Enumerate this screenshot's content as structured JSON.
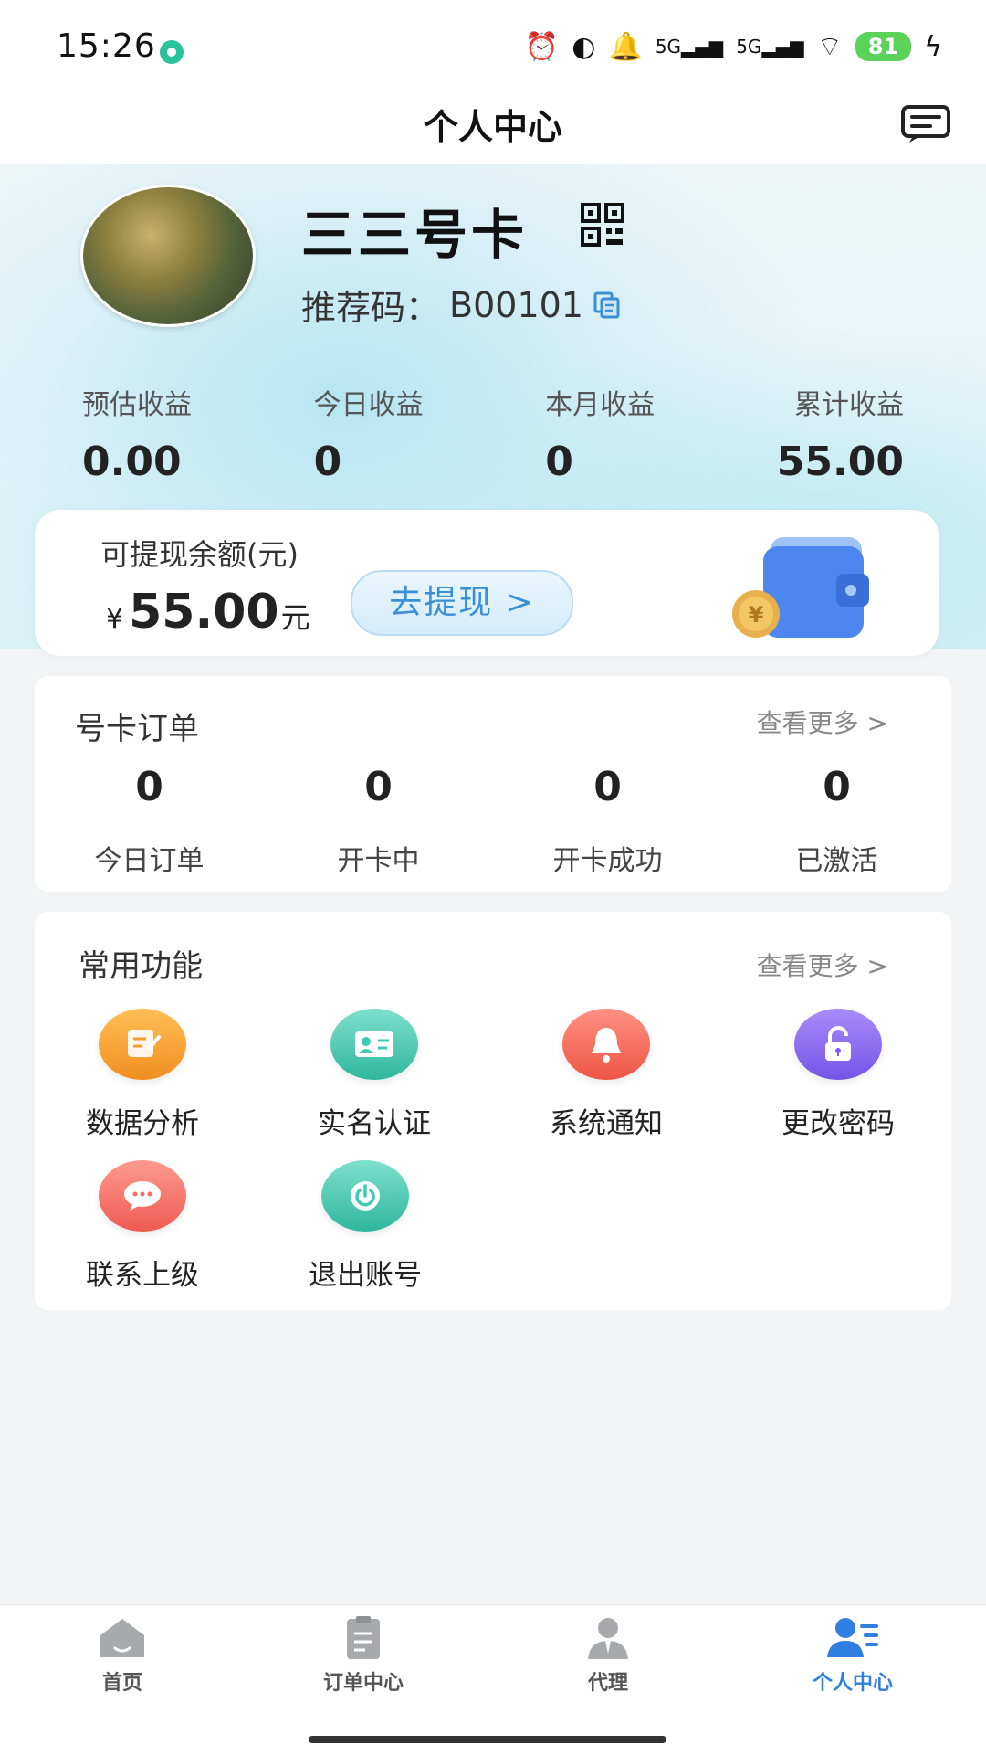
{
  "status_bar": {
    "time": "15:26",
    "battery": "81",
    "network_1": "5G",
    "network_2": "5G"
  },
  "header": {
    "title": "个人中心",
    "message_icon": "message-square-icon"
  },
  "profile": {
    "name": "三三号卡",
    "referral_label": "推荐码：",
    "referral_code": "B00101"
  },
  "stats": [
    {
      "label": "预估收益",
      "value": "0.00"
    },
    {
      "label": "今日收益",
      "value": "0"
    },
    {
      "label": "本月收益",
      "value": "0"
    },
    {
      "label": "累计收益",
      "value": "55.00"
    }
  ],
  "balance": {
    "label": "可提现余额(元)",
    "currency": "¥",
    "amount": "55.00",
    "unit": "元",
    "withdraw_label": "去提现 >"
  },
  "orders": {
    "title": "号卡订单",
    "more": "查看更多 >",
    "items": [
      {
        "count": "0",
        "label": "今日订单"
      },
      {
        "count": "0",
        "label": "开卡中"
      },
      {
        "count": "0",
        "label": "开卡成功"
      },
      {
        "count": "0",
        "label": "已激活"
      }
    ]
  },
  "functions": {
    "title": "常用功能",
    "more": "查看更多 >",
    "items": [
      {
        "label": "数据分析",
        "icon": "edit-icon",
        "color": "#f9a23a"
      },
      {
        "label": "实名认证",
        "icon": "id-card-icon",
        "color": "#3fcab2"
      },
      {
        "label": "系统通知",
        "icon": "bell-icon",
        "color": "#f2685a"
      },
      {
        "label": "更改密码",
        "icon": "lock-icon",
        "color": "#8c6ff0"
      },
      {
        "label": "联系上级",
        "icon": "chat-icon",
        "color": "#f26e66"
      },
      {
        "label": "退出账号",
        "icon": "power-icon",
        "color": "#3fcab2"
      }
    ]
  },
  "bottom_nav": [
    {
      "label": "首页",
      "icon": "home-icon",
      "active": false
    },
    {
      "label": "订单中心",
      "icon": "clipboard-icon",
      "active": false
    },
    {
      "label": "代理",
      "icon": "agent-icon",
      "active": false
    },
    {
      "label": "个人中心",
      "icon": "user-list-icon",
      "active": true
    }
  ],
  "colors": {
    "accent": "#2e7fe0",
    "withdraw_text": "#3b8fd5"
  }
}
